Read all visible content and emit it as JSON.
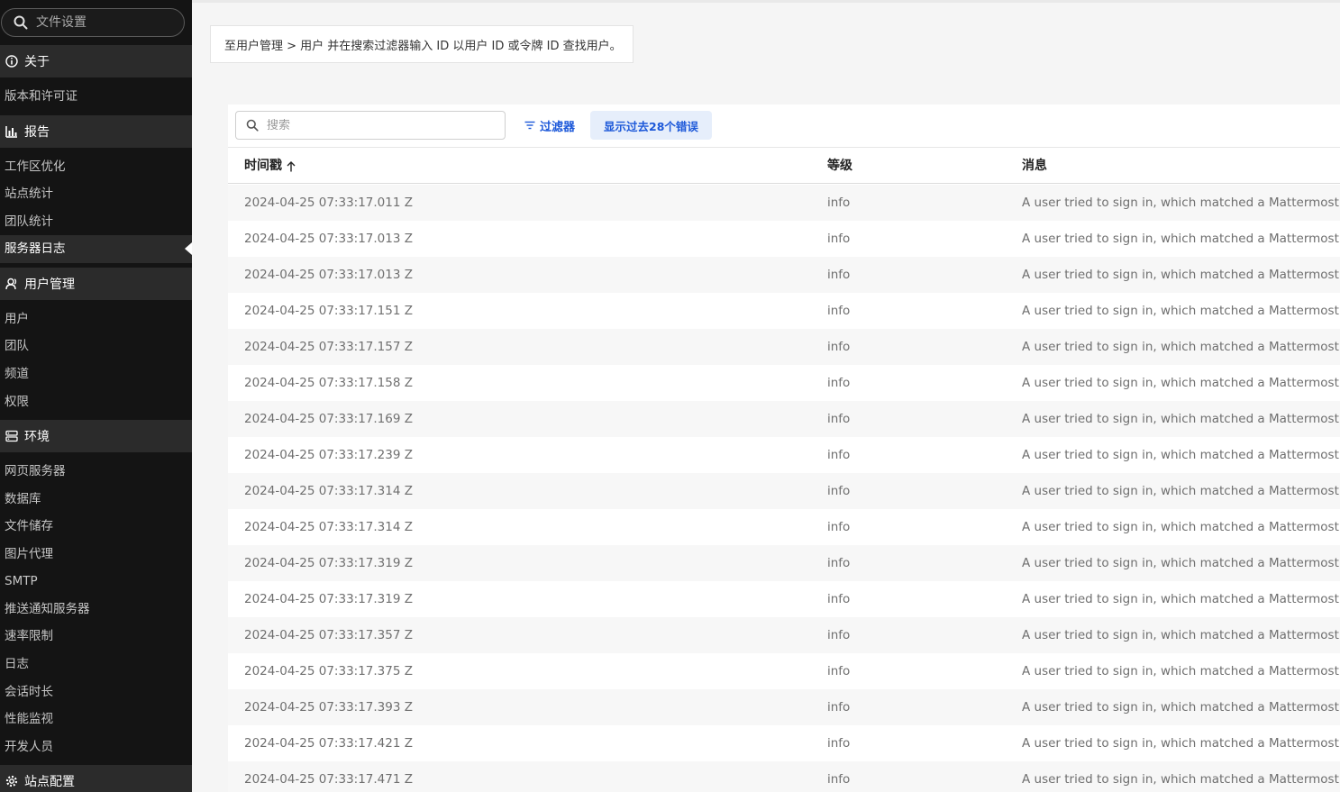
{
  "sidebar": {
    "search_placeholder": "文件设置",
    "sections": [
      {
        "header": "关于",
        "icon": "info-icon",
        "items": [
          "版本和许可证"
        ]
      },
      {
        "header": "报告",
        "icon": "bar-chart-icon",
        "items": [
          "工作区优化",
          "站点统计",
          "团队统计",
          "服务器日志"
        ]
      },
      {
        "header": "用户管理",
        "icon": "users-icon",
        "items": [
          "用户",
          "团队",
          "频道",
          "权限"
        ]
      },
      {
        "header": "环境",
        "icon": "server-icon",
        "items": [
          "网页服务器",
          "数据库",
          "文件储存",
          "图片代理",
          "SMTP",
          "推送通知服务器",
          "速率限制",
          "日志",
          "会话时长",
          "性能监视",
          "开发人员"
        ]
      },
      {
        "header": "站点配置",
        "icon": "gear-icon",
        "items": []
      }
    ],
    "active_item": "服务器日志"
  },
  "banner": {
    "text": "至用户管理 > 用户 并在搜索过滤器输入 ID 以用户 ID 或令牌 ID 查找用户。"
  },
  "toolbar": {
    "search_placeholder": "搜索",
    "filter_label": "过滤器",
    "errors_label": "显示过去28个错误"
  },
  "table": {
    "headers": {
      "timestamp": "时间戳",
      "level": "等级",
      "message": "消息"
    },
    "rows": [
      {
        "timestamp": "2024-04-25 07:33:17.011 Z",
        "level": "info",
        "message": "A user tried to sign in, which matched a Mattermost ac"
      },
      {
        "timestamp": "2024-04-25 07:33:17.013 Z",
        "level": "info",
        "message": "A user tried to sign in, which matched a Mattermost ac"
      },
      {
        "timestamp": "2024-04-25 07:33:17.013 Z",
        "level": "info",
        "message": "A user tried to sign in, which matched a Mattermost ac"
      },
      {
        "timestamp": "2024-04-25 07:33:17.151 Z",
        "level": "info",
        "message": "A user tried to sign in, which matched a Mattermost ac"
      },
      {
        "timestamp": "2024-04-25 07:33:17.157 Z",
        "level": "info",
        "message": "A user tried to sign in, which matched a Mattermost ac"
      },
      {
        "timestamp": "2024-04-25 07:33:17.158 Z",
        "level": "info",
        "message": "A user tried to sign in, which matched a Mattermost ac"
      },
      {
        "timestamp": "2024-04-25 07:33:17.169 Z",
        "level": "info",
        "message": "A user tried to sign in, which matched a Mattermost ac"
      },
      {
        "timestamp": "2024-04-25 07:33:17.239 Z",
        "level": "info",
        "message": "A user tried to sign in, which matched a Mattermost ac"
      },
      {
        "timestamp": "2024-04-25 07:33:17.314 Z",
        "level": "info",
        "message": "A user tried to sign in, which matched a Mattermost ac"
      },
      {
        "timestamp": "2024-04-25 07:33:17.314 Z",
        "level": "info",
        "message": "A user tried to sign in, which matched a Mattermost ac"
      },
      {
        "timestamp": "2024-04-25 07:33:17.319 Z",
        "level": "info",
        "message": "A user tried to sign in, which matched a Mattermost ac"
      },
      {
        "timestamp": "2024-04-25 07:33:17.319 Z",
        "level": "info",
        "message": "A user tried to sign in, which matched a Mattermost ac"
      },
      {
        "timestamp": "2024-04-25 07:33:17.357 Z",
        "level": "info",
        "message": "A user tried to sign in, which matched a Mattermost ac"
      },
      {
        "timestamp": "2024-04-25 07:33:17.375 Z",
        "level": "info",
        "message": "A user tried to sign in, which matched a Mattermost ac"
      },
      {
        "timestamp": "2024-04-25 07:33:17.393 Z",
        "level": "info",
        "message": "A user tried to sign in, which matched a Mattermost ac"
      },
      {
        "timestamp": "2024-04-25 07:33:17.421 Z",
        "level": "info",
        "message": "A user tried to sign in, which matched a Mattermost ac"
      },
      {
        "timestamp": "2024-04-25 07:33:17.471 Z",
        "level": "info",
        "message": "A user tried to sign in, which matched a Mattermost ac"
      }
    ]
  },
  "colors": {
    "sidebar_bg": "#141414",
    "sidebar_header_bg": "#2b2b2b",
    "accent": "#1c58d9"
  }
}
